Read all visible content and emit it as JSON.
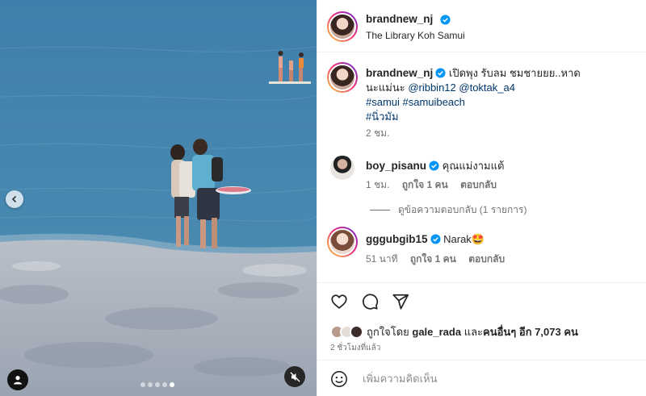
{
  "post": {
    "author": "brandnew_nj",
    "location": "The Library Koh Samui",
    "carousel": {
      "total": 5,
      "active": 4
    }
  },
  "caption": {
    "username": "brandnew_nj",
    "text": "เปิดพุง รับลม ชมชายยย..หาด",
    "text2": "นะแม่นะ ",
    "mention1": "@ribbin12",
    "mention2": "@toktak_a4",
    "hashtags1": "#samui #samuibeach",
    "hashtags2": "#นิ่วมัม",
    "time": "2 ชม."
  },
  "comments": [
    {
      "username": "boy_pisanu",
      "text": "คุณแม่งามแต้",
      "time": "1 ชม.",
      "likes": "ถูกใจ 1 คน",
      "reply": "ตอบกลับ"
    },
    {
      "username": "gggubgib15",
      "text": "Narak🤩",
      "time": "51 นาที",
      "likes": "ถูกใจ 1 คน",
      "reply": "ตอบกลับ"
    }
  ],
  "view_replies": "ดูข้อความตอบกลับ (1 รายการ)",
  "likes": {
    "prefix": "ถูกใจโดย",
    "user": "gale_rada",
    "middle": "และ",
    "others": "คนอื่นๆ อีก 7,073 คน"
  },
  "posted_ago": "2 ชั่วโมงที่แล้ว",
  "add_comment": {
    "placeholder": "เพิ่มความคิดเห็น"
  },
  "icons": {
    "prev": "chevron-left-icon",
    "user_tag": "user-icon",
    "mute": "speaker-muted-icon",
    "verified": "verified-badge-icon",
    "like": "heart-icon",
    "comment": "comment-icon",
    "share": "paper-plane-icon",
    "emoji": "smiley-icon"
  },
  "colors": {
    "link": "#00376b",
    "verified": "#0095f6",
    "muted_text": "#737373"
  }
}
